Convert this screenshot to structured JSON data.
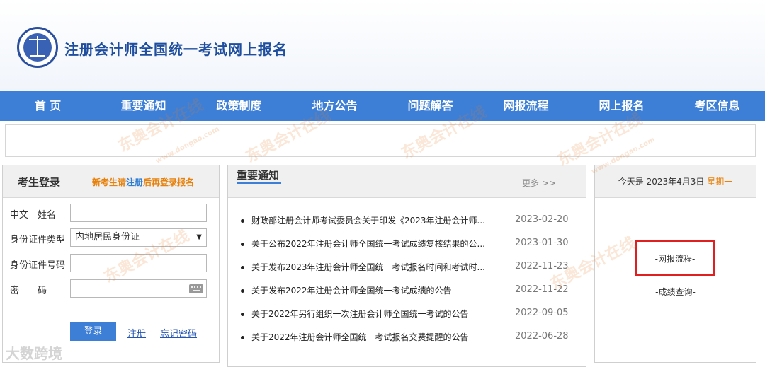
{
  "header": {
    "title": "注册会计师全国统一考试网上报名"
  },
  "nav": [
    "首 页",
    "重要通知",
    "政策制度",
    "地方公告",
    "问题解答",
    "网报流程",
    "网上报名",
    "考区信息"
  ],
  "login": {
    "title": "考生登录",
    "hint_pre": "新考生请",
    "hint_link": "注册",
    "hint_post": "后再登录报名",
    "name_label": "中文　姓名",
    "idtype_label": "身份证件类型",
    "idtype_value": "内地居民身份证",
    "idno_label": "身份证件号码",
    "password_label": "密　　码",
    "login_button": "登录",
    "register_link": "注册",
    "forgot_link": "忘记密码"
  },
  "notices": {
    "tab": "重要通知",
    "more": "更多 >>",
    "items": [
      {
        "title": "财政部注册会计师考试委员会关于印发《2023年注册会计师...",
        "date": "2023-02-20"
      },
      {
        "title": "关于公布2022年注册会计师全国统一考试成绩复核结果的公...",
        "date": "2023-01-30"
      },
      {
        "title": "关于发布2023年注册会计师全国统一考试报名时间和考试时...",
        "date": "2022-11-23"
      },
      {
        "title": "关于发布2022年注册会计师全国统一考试成绩的公告",
        "date": "2022-11-22"
      },
      {
        "title": "关于2022年另行组织一次注册会计师全国统一考试的公告",
        "date": "2022-09-05"
      },
      {
        "title": "关于2022年注册会计师全国统一考试报名交费提醒的公告",
        "date": "2022-06-28"
      }
    ]
  },
  "side": {
    "date_pre": "今天是 2023年4月3日",
    "weekday": "星期一",
    "flow_link": "-网报流程-",
    "score_link": "-成绩查询-"
  },
  "watermark": {
    "text": "东奥会计在线",
    "url": "www.dongao.com",
    "corner": "大数跨境"
  }
}
